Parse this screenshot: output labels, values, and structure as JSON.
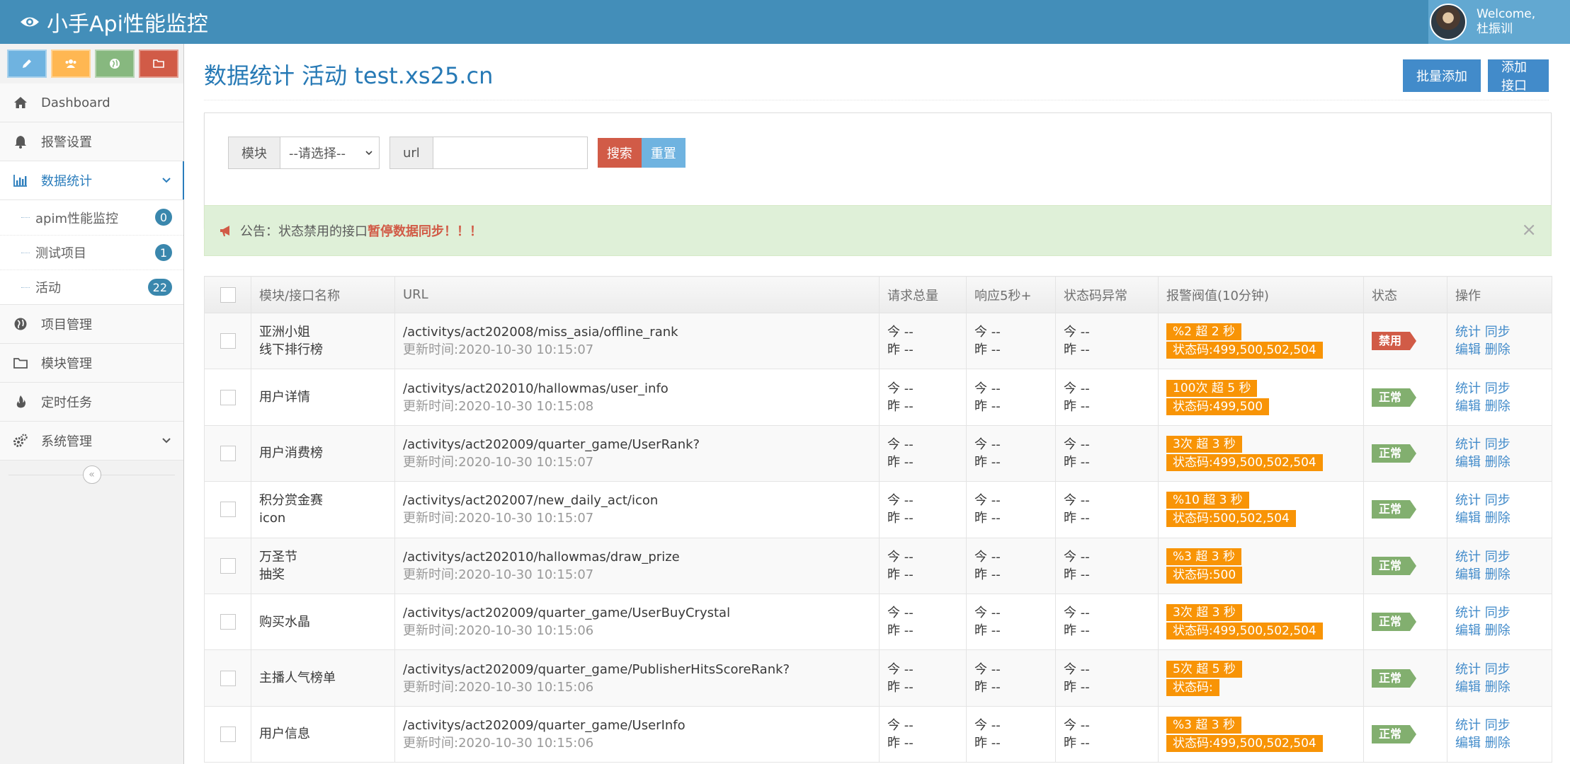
{
  "header": {
    "brand": "小手Api性能监控",
    "welcome": "Welcome,",
    "username": "杜振训"
  },
  "sidebar": {
    "items": [
      {
        "label": "Dashboard",
        "icon": "home-icon"
      },
      {
        "label": "报警设置",
        "icon": "bell-icon"
      },
      {
        "label": "数据统计",
        "icon": "bar-chart-icon"
      },
      {
        "label": "项目管理",
        "icon": "globe-icon"
      },
      {
        "label": "模块管理",
        "icon": "folder-icon"
      },
      {
        "label": "定时任务",
        "icon": "fire-icon"
      },
      {
        "label": "系统管理",
        "icon": "cogs-icon"
      }
    ],
    "submenu": [
      {
        "label": "apim性能监控",
        "count": "0"
      },
      {
        "label": "测试项目",
        "count": "1"
      },
      {
        "label": "活动",
        "count": "22"
      }
    ],
    "collapse": "«"
  },
  "page": {
    "title": "数据统计 活动 test.xs25.cn",
    "batch_add": "批量添加",
    "add_api": "添加接口"
  },
  "search": {
    "module_label": "模块",
    "module_value": "--请选择--",
    "url_label": "url",
    "url_value": "",
    "search_btn": "搜索",
    "reset_btn": "重置"
  },
  "alert": {
    "prefix": "公告：状态禁用的接口",
    "highlight": "暂停数据同步",
    "suffix": "！！！",
    "close": "×"
  },
  "table": {
    "headers": [
      "模块/接口名称",
      "URL",
      "请求总量",
      "响应5秒+",
      "状态码异常",
      "报警阀值(10分钟)",
      "状态",
      "操作"
    ],
    "today": "今 --",
    "yesterday": "昨 --",
    "ops": {
      "stats": "统计",
      "sync": "同步",
      "edit": "编辑",
      "delete": "删除"
    },
    "rows": [
      {
        "module": "亚洲小姐",
        "name": "线下排行榜",
        "url": "/activitys/act202008/miss_asia/offline_rank",
        "updated": "更新时间:2020-10-30 10:15:07",
        "threshold": "%2 超 2 秒",
        "codes": "状态码:499,500,502,504",
        "status": "禁用"
      },
      {
        "module": "",
        "name": "用户详情",
        "url": "/activitys/act202010/hallowmas/user_info",
        "updated": "更新时间:2020-10-30 10:15:08",
        "threshold": "100次 超 5 秒",
        "codes": "状态码:499,500",
        "status": "正常"
      },
      {
        "module": "",
        "name": "用户消费榜",
        "url": "/activitys/act202009/quarter_game/UserRank?",
        "updated": "更新时间:2020-10-30 10:15:07",
        "threshold": "3次 超 3 秒",
        "codes": "状态码:499,500,502,504",
        "status": "正常"
      },
      {
        "module": "积分赏金赛",
        "name": "icon",
        "url": "/activitys/act202007/new_daily_act/icon",
        "updated": "更新时间:2020-10-30 10:15:07",
        "threshold": "%10 超 3 秒",
        "codes": "状态码:500,502,504",
        "status": "正常"
      },
      {
        "module": "万圣节",
        "name": "抽奖",
        "url": "/activitys/act202010/hallowmas/draw_prize",
        "updated": "更新时间:2020-10-30 10:15:07",
        "threshold": "%3 超 3 秒",
        "codes": "状态码:500",
        "status": "正常"
      },
      {
        "module": "",
        "name": "购买水晶",
        "url": "/activitys/act202009/quarter_game/UserBuyCrystal",
        "updated": "更新时间:2020-10-30 10:15:06",
        "threshold": "3次 超 3 秒",
        "codes": "状态码:499,500,502,504",
        "status": "正常"
      },
      {
        "module": "",
        "name": "主播人气榜单",
        "url": "/activitys/act202009/quarter_game/PublisherHitsScoreRank?",
        "updated": "更新时间:2020-10-30 10:15:06",
        "threshold": "5次 超 5 秒",
        "codes": "状态码:",
        "status": "正常"
      },
      {
        "module": "",
        "name": "用户信息",
        "url": "/activitys/act202009/quarter_game/UserInfo",
        "updated": "更新时间:2020-10-30 10:15:06",
        "threshold": "%3 超 3 秒",
        "codes": "状态码:499,500,502,504",
        "status": "正常"
      }
    ]
  },
  "colors": {
    "navbar": "#438eb9",
    "title": "#2679b5",
    "threshold": "#f89406",
    "status_ok": "#82af6f",
    "status_off": "#d15b47",
    "link": "#428bca"
  }
}
